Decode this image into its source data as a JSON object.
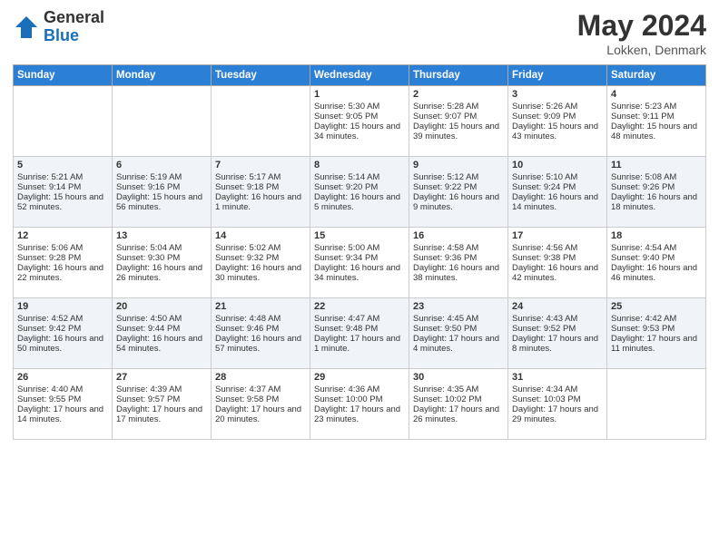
{
  "header": {
    "logo_general": "General",
    "logo_blue": "Blue",
    "month_year": "May 2024",
    "location": "Lokken, Denmark"
  },
  "days_of_week": [
    "Sunday",
    "Monday",
    "Tuesday",
    "Wednesday",
    "Thursday",
    "Friday",
    "Saturday"
  ],
  "weeks": [
    [
      {
        "day": "",
        "content": ""
      },
      {
        "day": "",
        "content": ""
      },
      {
        "day": "",
        "content": ""
      },
      {
        "day": "1",
        "sunrise": "Sunrise: 5:30 AM",
        "sunset": "Sunset: 9:05 PM",
        "daylight": "Daylight: 15 hours and 34 minutes."
      },
      {
        "day": "2",
        "sunrise": "Sunrise: 5:28 AM",
        "sunset": "Sunset: 9:07 PM",
        "daylight": "Daylight: 15 hours and 39 minutes."
      },
      {
        "day": "3",
        "sunrise": "Sunrise: 5:26 AM",
        "sunset": "Sunset: 9:09 PM",
        "daylight": "Daylight: 15 hours and 43 minutes."
      },
      {
        "day": "4",
        "sunrise": "Sunrise: 5:23 AM",
        "sunset": "Sunset: 9:11 PM",
        "daylight": "Daylight: 15 hours and 48 minutes."
      }
    ],
    [
      {
        "day": "5",
        "sunrise": "Sunrise: 5:21 AM",
        "sunset": "Sunset: 9:14 PM",
        "daylight": "Daylight: 15 hours and 52 minutes."
      },
      {
        "day": "6",
        "sunrise": "Sunrise: 5:19 AM",
        "sunset": "Sunset: 9:16 PM",
        "daylight": "Daylight: 15 hours and 56 minutes."
      },
      {
        "day": "7",
        "sunrise": "Sunrise: 5:17 AM",
        "sunset": "Sunset: 9:18 PM",
        "daylight": "Daylight: 16 hours and 1 minute."
      },
      {
        "day": "8",
        "sunrise": "Sunrise: 5:14 AM",
        "sunset": "Sunset: 9:20 PM",
        "daylight": "Daylight: 16 hours and 5 minutes."
      },
      {
        "day": "9",
        "sunrise": "Sunrise: 5:12 AM",
        "sunset": "Sunset: 9:22 PM",
        "daylight": "Daylight: 16 hours and 9 minutes."
      },
      {
        "day": "10",
        "sunrise": "Sunrise: 5:10 AM",
        "sunset": "Sunset: 9:24 PM",
        "daylight": "Daylight: 16 hours and 14 minutes."
      },
      {
        "day": "11",
        "sunrise": "Sunrise: 5:08 AM",
        "sunset": "Sunset: 9:26 PM",
        "daylight": "Daylight: 16 hours and 18 minutes."
      }
    ],
    [
      {
        "day": "12",
        "sunrise": "Sunrise: 5:06 AM",
        "sunset": "Sunset: 9:28 PM",
        "daylight": "Daylight: 16 hours and 22 minutes."
      },
      {
        "day": "13",
        "sunrise": "Sunrise: 5:04 AM",
        "sunset": "Sunset: 9:30 PM",
        "daylight": "Daylight: 16 hours and 26 minutes."
      },
      {
        "day": "14",
        "sunrise": "Sunrise: 5:02 AM",
        "sunset": "Sunset: 9:32 PM",
        "daylight": "Daylight: 16 hours and 30 minutes."
      },
      {
        "day": "15",
        "sunrise": "Sunrise: 5:00 AM",
        "sunset": "Sunset: 9:34 PM",
        "daylight": "Daylight: 16 hours and 34 minutes."
      },
      {
        "day": "16",
        "sunrise": "Sunrise: 4:58 AM",
        "sunset": "Sunset: 9:36 PM",
        "daylight": "Daylight: 16 hours and 38 minutes."
      },
      {
        "day": "17",
        "sunrise": "Sunrise: 4:56 AM",
        "sunset": "Sunset: 9:38 PM",
        "daylight": "Daylight: 16 hours and 42 minutes."
      },
      {
        "day": "18",
        "sunrise": "Sunrise: 4:54 AM",
        "sunset": "Sunset: 9:40 PM",
        "daylight": "Daylight: 16 hours and 46 minutes."
      }
    ],
    [
      {
        "day": "19",
        "sunrise": "Sunrise: 4:52 AM",
        "sunset": "Sunset: 9:42 PM",
        "daylight": "Daylight: 16 hours and 50 minutes."
      },
      {
        "day": "20",
        "sunrise": "Sunrise: 4:50 AM",
        "sunset": "Sunset: 9:44 PM",
        "daylight": "Daylight: 16 hours and 54 minutes."
      },
      {
        "day": "21",
        "sunrise": "Sunrise: 4:48 AM",
        "sunset": "Sunset: 9:46 PM",
        "daylight": "Daylight: 16 hours and 57 minutes."
      },
      {
        "day": "22",
        "sunrise": "Sunrise: 4:47 AM",
        "sunset": "Sunset: 9:48 PM",
        "daylight": "Daylight: 17 hours and 1 minute."
      },
      {
        "day": "23",
        "sunrise": "Sunrise: 4:45 AM",
        "sunset": "Sunset: 9:50 PM",
        "daylight": "Daylight: 17 hours and 4 minutes."
      },
      {
        "day": "24",
        "sunrise": "Sunrise: 4:43 AM",
        "sunset": "Sunset: 9:52 PM",
        "daylight": "Daylight: 17 hours and 8 minutes."
      },
      {
        "day": "25",
        "sunrise": "Sunrise: 4:42 AM",
        "sunset": "Sunset: 9:53 PM",
        "daylight": "Daylight: 17 hours and 11 minutes."
      }
    ],
    [
      {
        "day": "26",
        "sunrise": "Sunrise: 4:40 AM",
        "sunset": "Sunset: 9:55 PM",
        "daylight": "Daylight: 17 hours and 14 minutes."
      },
      {
        "day": "27",
        "sunrise": "Sunrise: 4:39 AM",
        "sunset": "Sunset: 9:57 PM",
        "daylight": "Daylight: 17 hours and 17 minutes."
      },
      {
        "day": "28",
        "sunrise": "Sunrise: 4:37 AM",
        "sunset": "Sunset: 9:58 PM",
        "daylight": "Daylight: 17 hours and 20 minutes."
      },
      {
        "day": "29",
        "sunrise": "Sunrise: 4:36 AM",
        "sunset": "Sunset: 10:00 PM",
        "daylight": "Daylight: 17 hours and 23 minutes."
      },
      {
        "day": "30",
        "sunrise": "Sunrise: 4:35 AM",
        "sunset": "Sunset: 10:02 PM",
        "daylight": "Daylight: 17 hours and 26 minutes."
      },
      {
        "day": "31",
        "sunrise": "Sunrise: 4:34 AM",
        "sunset": "Sunset: 10:03 PM",
        "daylight": "Daylight: 17 hours and 29 minutes."
      },
      {
        "day": "",
        "content": ""
      }
    ]
  ]
}
